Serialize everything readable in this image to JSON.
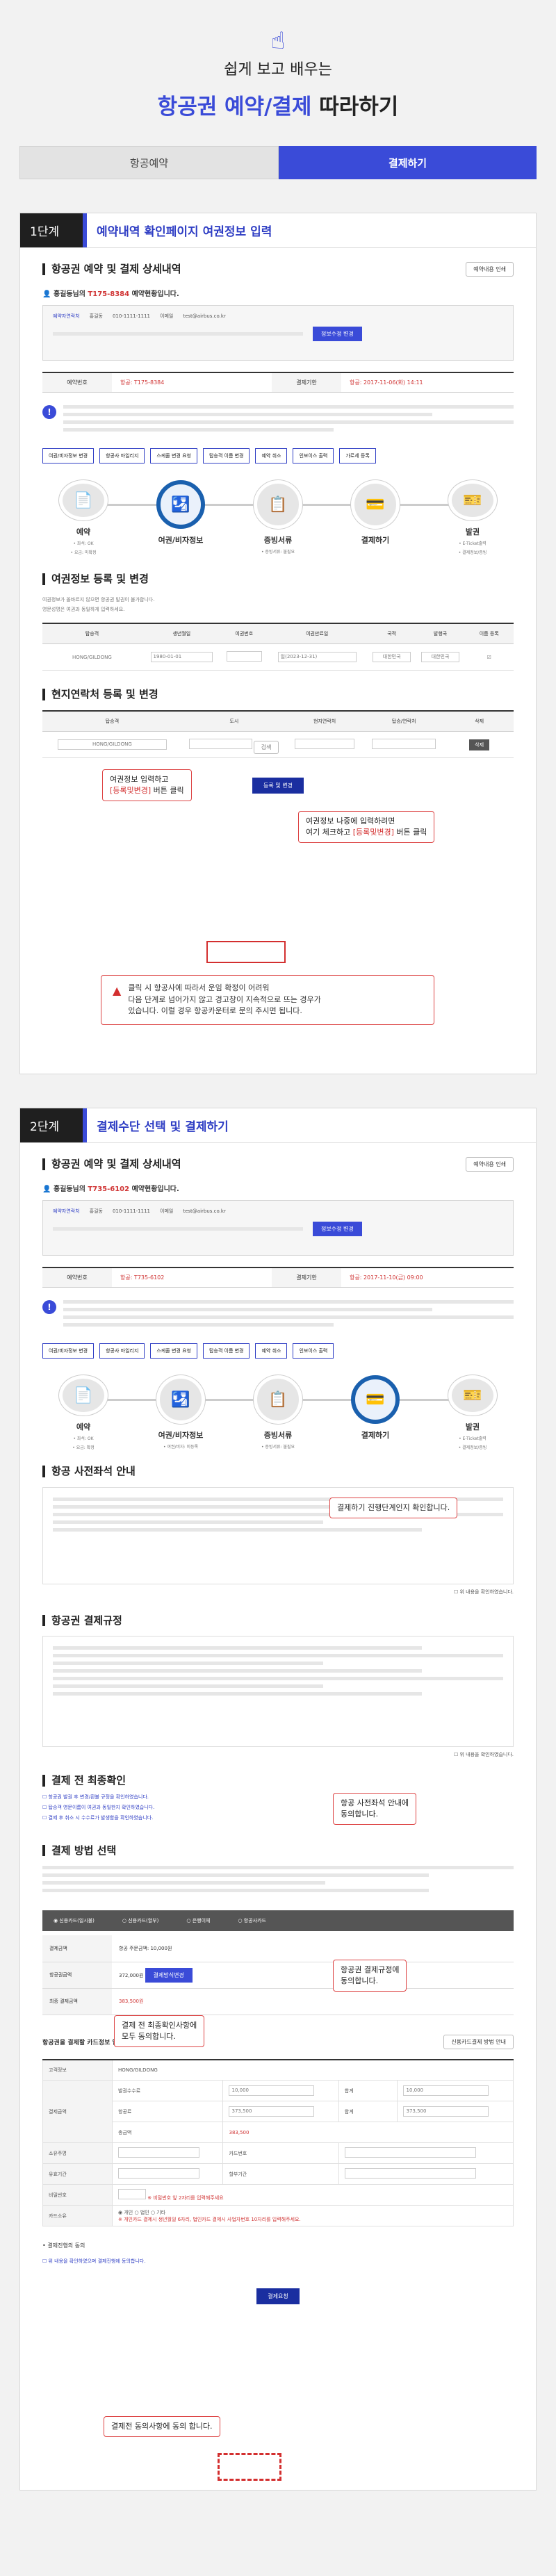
{
  "hero": {
    "subtitle": "쉽게 보고 배우는",
    "title_highlight": "항공권 예약/결제",
    "title_rest": " 따라하기"
  },
  "tabs": [
    {
      "label": "항공예약"
    },
    {
      "label": "결제하기"
    }
  ],
  "colors": {
    "accent": "#3a4bd8",
    "alert": "#d32f2f",
    "active_step": "#1a60ae"
  },
  "step1": {
    "num": "1단계",
    "title": "예약내역 확인페이지 여권정보 입력",
    "section_res": "항공권 예약 및 결제 상세내역",
    "print_btn": "예약내용 인쇄",
    "resnum_prefix": "홍길동님의 ",
    "resnum_value": "T175-8384",
    "resnum_suffix": " 예약현황입니다.",
    "info": {
      "name_label": "예약자연락처",
      "name": "홍길동",
      "phone": "010-1111-1111",
      "email_label": "이메일",
      "email": "test@airbus.co.kr",
      "btn": "정보수정 변경"
    },
    "summary": {
      "h1": "예약번호",
      "v1": "항공: T175-8384",
      "h2": "결제기한",
      "v2": "항공: 2017-11-06(화) 14:11"
    },
    "menubtns": [
      "여권/비자정보 변경",
      "항공사 마일리지",
      "스케줄 변경 요청",
      "탑승객 이름 변경",
      "예약 취소",
      "인보이스 출력",
      "가로세 등록"
    ],
    "flow": [
      {
        "label": "예약",
        "sub1": "• 좌석: OK",
        "sub2": "• 요금: 미확정",
        "icon": "📄",
        "active": false
      },
      {
        "label": "여권/비자정보",
        "sub1": "",
        "sub2": "",
        "icon": "🛂",
        "active": true
      },
      {
        "label": "증빙서류",
        "sub1": "• 증빙서류: 불필요",
        "sub2": "",
        "icon": "📋",
        "active": false
      },
      {
        "label": "결제하기",
        "sub1": "",
        "sub2": "",
        "icon": "💳",
        "active": false
      },
      {
        "label": "발권",
        "sub1": "• E-Ticket출력",
        "sub2": "• 결제정보/증빙",
        "icon": "🎫",
        "active": false
      }
    ],
    "passport": {
      "section": "여권정보 등록 및 변경",
      "note1": "여권정보가 올바르지 않으면 항공권 발권이 불가합니다.",
      "note2": "영문성명은 여권과 동일하게 입력하세요.",
      "headers": [
        "탑승객",
        "생년월일",
        "여권번호",
        "여권만료일",
        "국적",
        "발행국",
        "이름 등록"
      ],
      "row": {
        "name": "HONG/GILDONG",
        "birth": "1980-01-01",
        "passport": "",
        "expiry": "일(2023-12-31)",
        "nation": "대한민국",
        "issuer": "대한민국"
      }
    },
    "local": {
      "section": "현지연락처 등록 및 변경",
      "headers": [
        "탑승객",
        "도시",
        "현지연락처",
        "탑승/연락처",
        "삭제"
      ],
      "row": {
        "name": "HONG/GILDONG",
        "btn": "검색",
        "del": "삭제"
      }
    },
    "save_btn": "등록 및 변경",
    "callout1": {
      "l1": "여권정보 입력하고",
      "red": "[등록및변경]",
      "l2": " 버튼 클릭"
    },
    "callout2": {
      "l1": "여권정보 나중에 입력하려면",
      "l2a": "여기 체크하고 ",
      "red": "[등록및변경]",
      "l2b": " 버튼 클릭"
    },
    "warning": {
      "l1": "클릭 시 항공사에 따라서 운임 확정이 어려워",
      "l2": "다음 단계로 넘어가지 않고 경고창이 지속적으로 뜨는 경우가",
      "l3": "있습니다. 이럴 경우 항공카운터로 문의 주시면 됩니다."
    }
  },
  "step2": {
    "num": "2단계",
    "title": "결제수단 선택 및 결제하기",
    "section_res": "항공권 예약 및 결제 상세내역",
    "print_btn": "예약내용 인쇄",
    "resnum_prefix": "홍길동님의 ",
    "resnum_value": "T735-6102",
    "resnum_suffix": " 예약현황입니다.",
    "info": {
      "name_label": "예약자연락처",
      "name": "홍길동",
      "phone": "010-1111-1111",
      "email_label": "이메일",
      "email": "test@airbus.co.kr",
      "btn": "정보수정 변경"
    },
    "summary": {
      "h1": "예약번호",
      "v1": "항공: T735-6102",
      "h2": "결제기한",
      "v2": "항공: 2017-11-10(금) 09:00"
    },
    "menubtns": [
      "여권/비자정보 변경",
      "항공사 마일리지",
      "스케줄 변경 요청",
      "탑승객 이름 변경",
      "예약 취소",
      "인보이스 출력"
    ],
    "callout_flow": "결제하기 진행단계인지 확인합니다.",
    "flow": [
      {
        "label": "예약",
        "sub1": "• 좌석: OK",
        "sub2": "• 요금: 확정",
        "icon": "📄",
        "active": false
      },
      {
        "label": "여권/비자정보",
        "sub1": "• 여권/비자: 미등록",
        "sub2": "",
        "icon": "🛂",
        "active": false
      },
      {
        "label": "증빙서류",
        "sub1": "• 증빙서류: 불필요",
        "sub2": "",
        "icon": "📋",
        "active": false
      },
      {
        "label": "결제하기",
        "sub1": "",
        "sub2": "",
        "icon": "💳",
        "active": true
      },
      {
        "label": "발권",
        "sub1": "• E-Ticket출력",
        "sub2": "• 결제정보/증빙",
        "icon": "🎫",
        "active": false
      }
    ],
    "pre_seat": {
      "section": "항공 사전좌석 안내",
      "callout_l1": "항공 사전좌석 안내에",
      "callout_l2": "동의합니다.",
      "agree": "위 내용을 확인하였습니다."
    },
    "rules": {
      "section": "항공권 결제규정",
      "callout_l1": "항공권 결제규정에",
      "callout_l2": "동의합니다.",
      "agree": "위 내용을 확인하였습니다."
    },
    "final": {
      "section": "결제 전 최종확인",
      "callout_l1": "결제 전 최종확인사항에",
      "callout_l2": "모두 동의합니다.",
      "checks": [
        "항공권 발권 후 변경/환불 규정을 확인하였습니다.",
        "탑승객 영문이름이 여권과 동일한지 확인하였습니다.",
        "결제 후 취소 시 수수료가 발생함을 확인하였습니다."
      ]
    },
    "payment": {
      "section": "결제 방법 선택",
      "options": [
        "신용카드(일시불)",
        "신용카드(할부)",
        "은행이체",
        "항공사카드"
      ],
      "rows": [
        {
          "h": "결제금액",
          "v": "항공 주문금액: 10,000원"
        },
        {
          "h": "항공권금액",
          "v": "372,000원",
          "btn": "결제방식변경"
        },
        {
          "h": "최종 결제금액",
          "v": "383,500원"
        }
      ]
    },
    "card": {
      "title": "항공권을 결제할 카드정보 입력",
      "btn": "신용카드결제 방법 안내",
      "owner_h": "고객정보",
      "owner": "HONG/GILDONG",
      "amt_h": "결제금액",
      "amt_rows": [
        {
          "l": "발권수수료",
          "a": "10,000",
          "t": "10,000"
        },
        {
          "l": "항공료",
          "a": "373,500",
          "t": "373,500"
        }
      ],
      "total_label": "총금액",
      "total": "383,500",
      "fields": [
        "소유주명",
        "카드번호",
        "유효기간",
        "할부기간",
        "비밀번호"
      ],
      "pw_note": "※ 비밀번호 앞 2자리를 입력해주세요",
      "ev_h": "카드소유",
      "ev_opts": [
        "개인",
        "법인",
        "기타"
      ],
      "ev_note": "※ 개인카드 결제시 생년월일 6자리, 법인카드 결제시 사업자번호 10자리를 입력해주세요."
    },
    "agree_block": {
      "label": "• 결제진행의 동의",
      "check": "위 내용을 확인하였으며 결제진행에 동의합니다.",
      "callout": "결제전 동의사항에 동의 합니다."
    },
    "pay_btn": "결제요청"
  }
}
